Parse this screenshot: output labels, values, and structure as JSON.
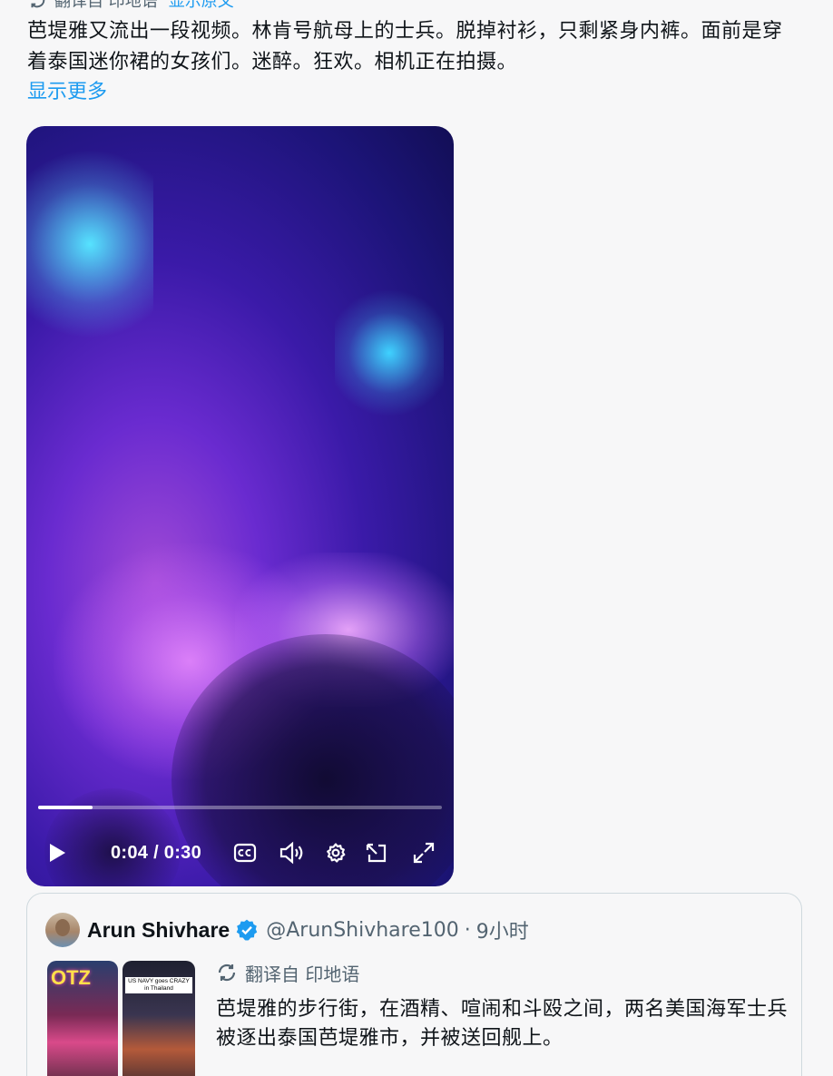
{
  "top_translate": {
    "label": "翻译自 印地语",
    "show_original": "显示原文"
  },
  "tweet": {
    "text": "芭堤雅又流出一段视频。林肯号航母上的士兵。脱掉衬衫，只剩紧身内裤。面前是穿着泰国迷你裙的女孩们。迷醉。狂欢。相机正在拍摄。",
    "show_more": "显示更多"
  },
  "video": {
    "time": "0:04 / 0:30",
    "progress": 0.135,
    "icons": [
      "play-icon",
      "captions-icon",
      "volume-icon",
      "settings-icon",
      "pop-out-icon",
      "fullscreen-icon"
    ]
  },
  "quote": {
    "name": "Arun Shivhare",
    "handle": "@ArunShivhare100",
    "separator": "·",
    "time": "9小时",
    "translate_label": "翻译自 印地语",
    "text": "芭堤雅的步行街，在酒精、喧闹和斗殴之间，两名美国海军士兵被逐出泰国芭堤雅市，并被送回舰上。",
    "thumb1_text": "OTZ",
    "thumb2_caption": "US NAVY goes CRAZY in Thailand"
  },
  "colors": {
    "link": "#1d9bf0",
    "secondary": "#536471",
    "verified": "#1d9bf0"
  }
}
